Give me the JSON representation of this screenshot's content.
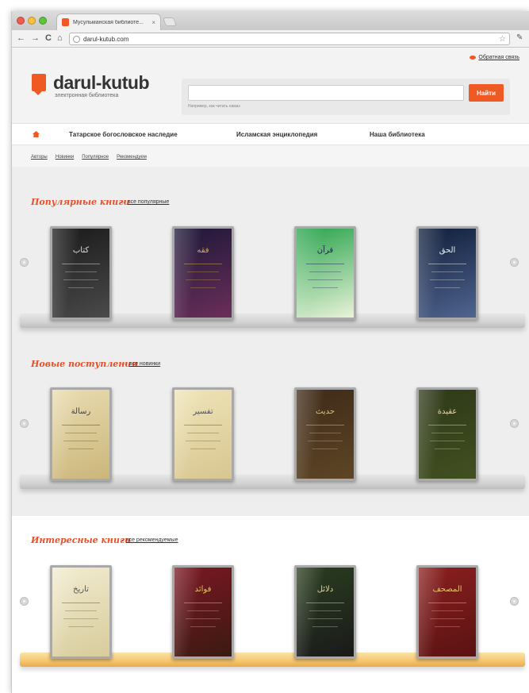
{
  "browser": {
    "tab_title": "Мусульманская библиоте...",
    "tab_close": "×",
    "url": "darul-kutub.com",
    "back": "←",
    "forward": "→",
    "reload": "C",
    "home": "⌂",
    "star": "☆",
    "wrench": "🔧"
  },
  "header": {
    "feedback": "Обратная связь",
    "logo_text": "darul-kutub",
    "logo_sub": "электронная библиотека",
    "search_button": "Найти",
    "search_hint": "Например, как читать намаз"
  },
  "nav": {
    "items": [
      "Татарское богословское наследие",
      "Исламская энциклопедия",
      "Наша библиотека"
    ]
  },
  "subnav": [
    "Авторы",
    "Новинки",
    "Популярное",
    "Рекомендуем"
  ],
  "sections": [
    {
      "title": "Популярные книги",
      "arrow": "→",
      "link": "все популярные",
      "books": [
        {
          "glyph": "كتاب",
          "colors": [
            "#1a1a1a",
            "#4a4a4a"
          ],
          "ink": "#ddd"
        },
        {
          "glyph": "فقه",
          "colors": [
            "#1d1838",
            "#6b2e5a"
          ],
          "ink": "#c9a94b"
        },
        {
          "glyph": "قرآن",
          "colors": [
            "#27a34b",
            "#e9f3d9"
          ],
          "ink": "#225"
        },
        {
          "glyph": "الحق",
          "colors": [
            "#0f1e3a",
            "#50648f"
          ],
          "ink": "#eee"
        }
      ]
    },
    {
      "title": "Новые поступления",
      "arrow": "→",
      "link": "все новинки",
      "books": [
        {
          "glyph": "رسالة",
          "colors": [
            "#e9dcb1",
            "#cbb67a"
          ],
          "ink": "#444"
        },
        {
          "glyph": "تفسير",
          "colors": [
            "#efe4b8",
            "#d7c690"
          ],
          "ink": "#555"
        },
        {
          "glyph": "حديث",
          "colors": [
            "#3e2a18",
            "#5e4525"
          ],
          "ink": "#d8c48c"
        },
        {
          "glyph": "عقيدة",
          "colors": [
            "#2e3818",
            "#415020"
          ],
          "ink": "#e0d6a6"
        }
      ]
    },
    {
      "title": "Интересные книги",
      "arrow": "→",
      "link": "все рекомендуемые",
      "books": [
        {
          "glyph": "تاريخ",
          "colors": [
            "#f1ebd0",
            "#d8cc9b"
          ],
          "ink": "#555"
        },
        {
          "glyph": "فوائد",
          "colors": [
            "#7a1722",
            "#3a1a12"
          ],
          "ink": "#e2c36c"
        },
        {
          "glyph": "دلائل",
          "colors": [
            "#2a3d1f",
            "#1a1a1a"
          ],
          "ink": "#e1d6a8"
        },
        {
          "glyph": "المصحف",
          "colors": [
            "#8a1f1f",
            "#5a1212"
          ],
          "ink": "#e6c46a"
        }
      ]
    }
  ]
}
